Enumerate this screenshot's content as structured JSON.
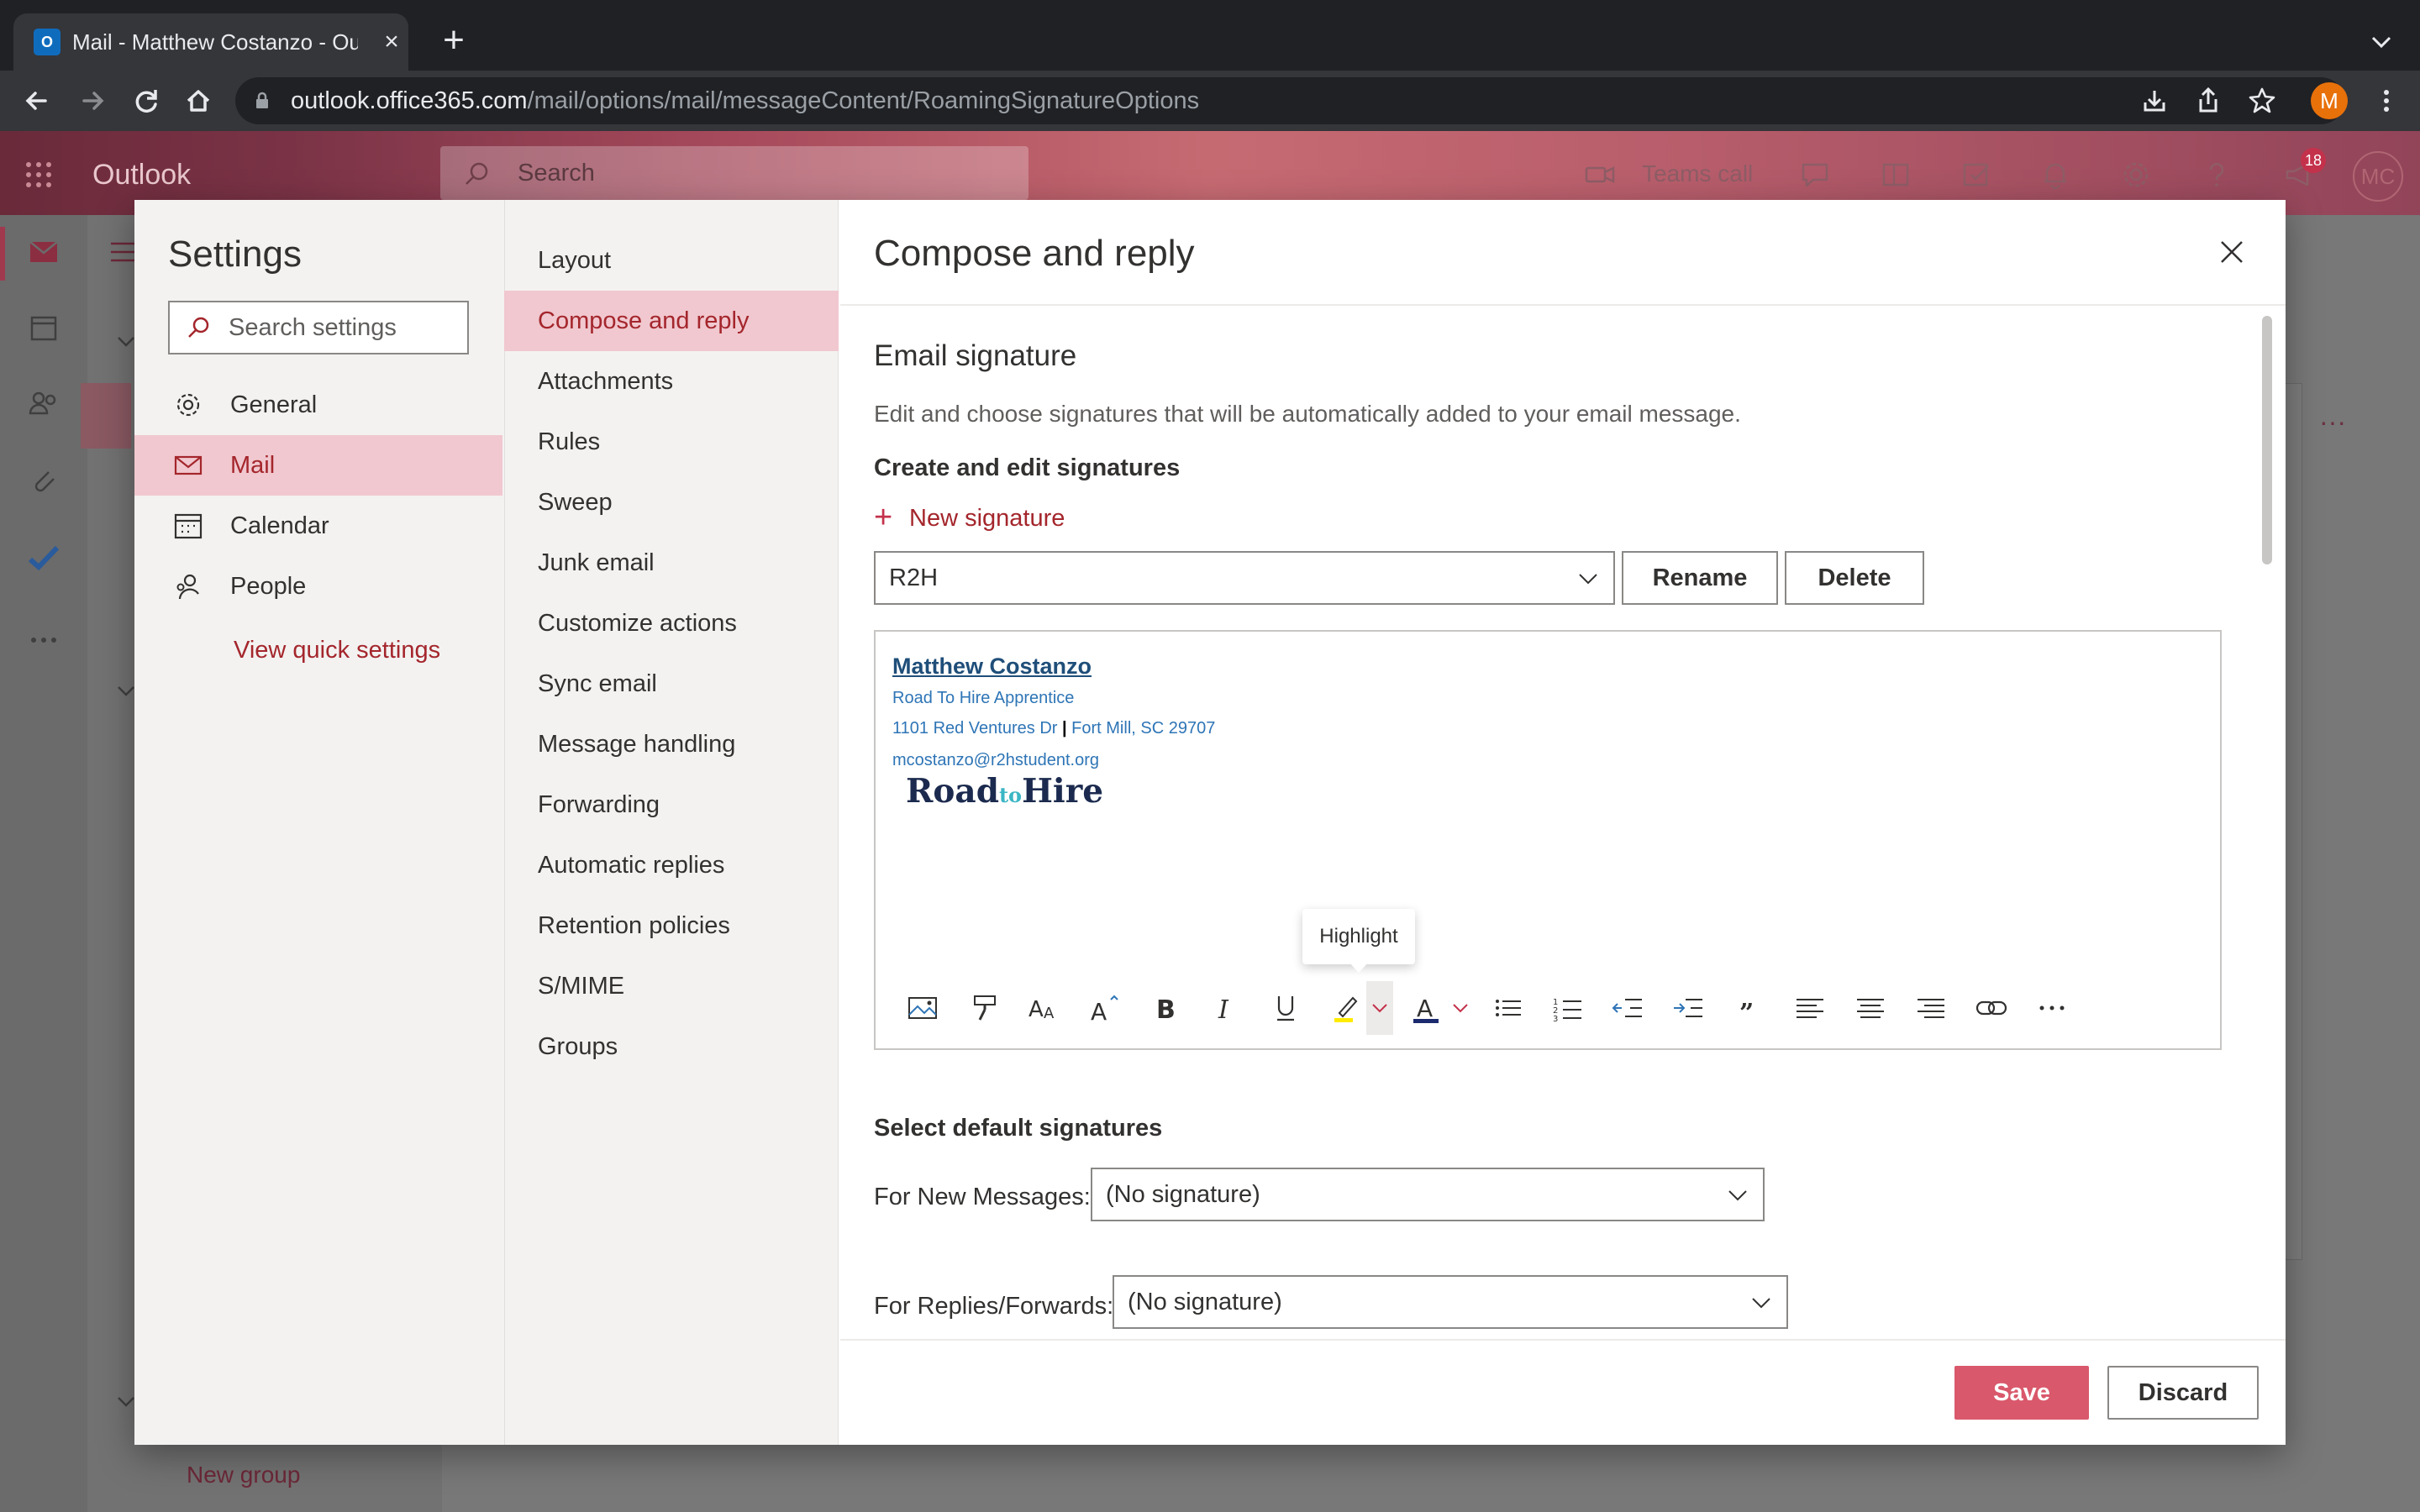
{
  "browser": {
    "tab_title": "Mail - Matthew Costanzo - Out",
    "url_host": "outlook.office365.com",
    "url_path": "/mail/options/mail/messageContent/RoamingSignatureOptions",
    "profile_initial": "M"
  },
  "header": {
    "app_name": "Outlook",
    "search_placeholder": "Search",
    "teams_call": "Teams call",
    "notification_count": "18",
    "user_initials": "MC"
  },
  "background": {
    "new_group": "New group",
    "more": "···"
  },
  "settings": {
    "title": "Settings",
    "search_placeholder": "Search settings",
    "categories": [
      {
        "label": "General",
        "icon": "gear-icon"
      },
      {
        "label": "Mail",
        "icon": "mail-icon"
      },
      {
        "label": "Calendar",
        "icon": "calendar-icon"
      },
      {
        "label": "People",
        "icon": "people-icon"
      }
    ],
    "view_quick_settings": "View quick settings",
    "subcategories": [
      "Layout",
      "Compose and reply",
      "Attachments",
      "Rules",
      "Sweep",
      "Junk email",
      "Customize actions",
      "Sync email",
      "Message handling",
      "Forwarding",
      "Automatic replies",
      "Retention policies",
      "S/MIME",
      "Groups"
    ],
    "active_subcategory": "Compose and reply"
  },
  "content": {
    "title": "Compose and reply",
    "section_title": "Email signature",
    "section_description": "Edit and choose signatures that will be automatically added to your email message.",
    "create_edit_label": "Create and edit signatures",
    "new_signature": "New signature",
    "selected_signature": "R2H",
    "rename": "Rename",
    "delete": "Delete",
    "signature": {
      "name": "Matthew Costanzo",
      "role": "Road To Hire Apprentice",
      "street": "1101 Red Ventures Dr",
      "separator": "|",
      "city": "Fort Mill, SC 29707",
      "email": "mcostanzo@r2hstudent.org",
      "logo_part1": "Road",
      "logo_part2": "to",
      "logo_part3": "Hire"
    },
    "tooltip": "Highlight",
    "toolbar_icons": [
      "insert-image-icon",
      "format-painter-icon",
      "font-size-icon",
      "font-grow-icon",
      "bold-icon",
      "italic-icon",
      "underline-icon",
      "highlight-icon",
      "font-color-icon",
      "bullets-icon",
      "numbering-icon",
      "outdent-icon",
      "indent-icon",
      "quote-icon",
      "align-left-icon",
      "align-center-icon",
      "align-right-icon",
      "link-icon",
      "more-options-icon"
    ],
    "default_signatures_title": "Select default signatures",
    "for_new_label": "For New Messages:",
    "for_new_value": "(No signature)",
    "for_reply_label": "For Replies/Forwards:",
    "for_reply_value": "(No signature)",
    "save": "Save",
    "discard": "Discard"
  },
  "colors": {
    "accent": "#a4262c",
    "save_button": "#d9586b",
    "selected_nav": "#f1c8cf",
    "signature_link": "#2e75b6"
  }
}
